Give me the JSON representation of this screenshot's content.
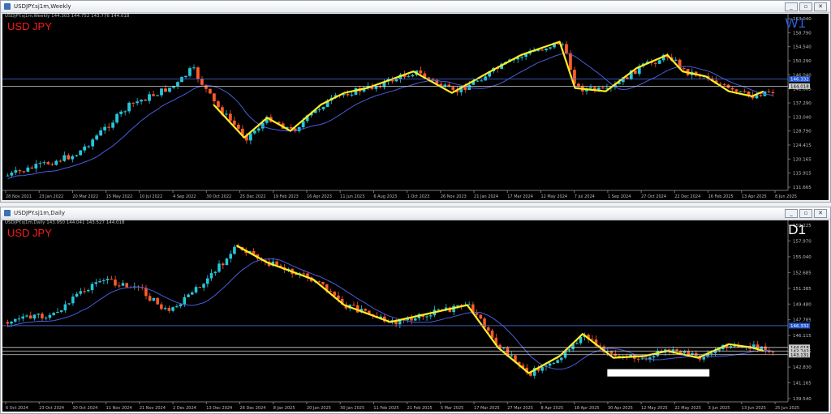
{
  "windows": [
    {
      "title": "USDJPY.sj1m,Weekly",
      "ohlc": "USDJPY.sj1m,Weekly  144.303 144.752 143.776 144.018",
      "symbol_label": "USD JPY",
      "timeframe_label": "W1",
      "timeframe_color": "#2e5fd6",
      "y_ticks": [
        "163.040",
        "158.790",
        "154.540",
        "150.290",
        "146.040",
        "141.665",
        "137.290",
        "133.040",
        "128.790",
        "124.415",
        "120.165",
        "115.915",
        "111.665"
      ],
      "x_ticks": [
        "28 Nov 2021",
        "23 Jan 2022",
        "20 Mar 2022",
        "15 May 2022",
        "10 Jul 2022",
        "4 Sep 2022",
        "30 Oct 2022",
        "25 Dec 2022",
        "19 Feb 2023",
        "16 Apr 2023",
        "11 Jun 2023",
        "6 Aug 2023",
        "1 Oct 2023",
        "26 Nov 2023",
        "21 Jan 2024",
        "17 Mar 2024",
        "12 May 2024",
        "7 Jul 2024",
        "1 Sep 2024",
        "27 Oct 2024",
        "22 Dec 2024",
        "16 Feb 2025",
        "13 Apr 2025",
        "8 Jun 2025"
      ],
      "price_tags": [
        {
          "text": "146.332",
          "bg": "#2255cc"
        },
        {
          "text": "144.018",
          "bg": "#cccccc"
        }
      ]
    },
    {
      "title": "USDJPY.sj1m,Daily",
      "ohlc": "USDJPY.sj1m,Daily  143.950 144.041 143.527 144.018",
      "symbol_label": "USD JPY",
      "timeframe_label": "D1",
      "timeframe_color": "#ffffff",
      "y_ticks": [
        "159.225",
        "157.970",
        "155.040",
        "152.685",
        "151.385",
        "149.480",
        "147.785",
        "146.115",
        "144.515",
        "142.830",
        "141.165",
        "139.540"
      ],
      "x_ticks": [
        "6 Oct 2024",
        "23 Oct 2024",
        "30 Oct 2024",
        "11 Nov 2024",
        "21 Nov 2024",
        "2 Dec 2024",
        "13 Dec 2024",
        "26 Dec 2024",
        "8 Jan 2025",
        "20 Jan 2025",
        "30 Jan 2025",
        "11 Feb 2025",
        "21 Feb 2025",
        "5 Mar 2025",
        "17 Mar 2025",
        "27 Mar 2025",
        "8 Apr 2025",
        "18 Apr 2025",
        "30 Apr 2025",
        "12 May 2025",
        "22 May 2025",
        "3 Jun 2025",
        "13 Jun 2025",
        "25 Jun 2025"
      ],
      "price_tags": [
        {
          "text": "146.332",
          "bg": "#2255cc"
        },
        {
          "text": "144.018",
          "bg": "#cccccc"
        },
        {
          "text": "143.743",
          "bg": "#cccccc"
        },
        {
          "text": "143.131",
          "bg": "#cccccc"
        }
      ]
    }
  ],
  "window_buttons": {
    "minimize": "_",
    "restore": "▫",
    "close": "✕"
  },
  "colors": {
    "bull": "#26c6da",
    "bear": "#ff5a2a",
    "ma": "#4a5cdc",
    "zigzag": "#ffee22",
    "hline": "#4a6ee0"
  }
}
